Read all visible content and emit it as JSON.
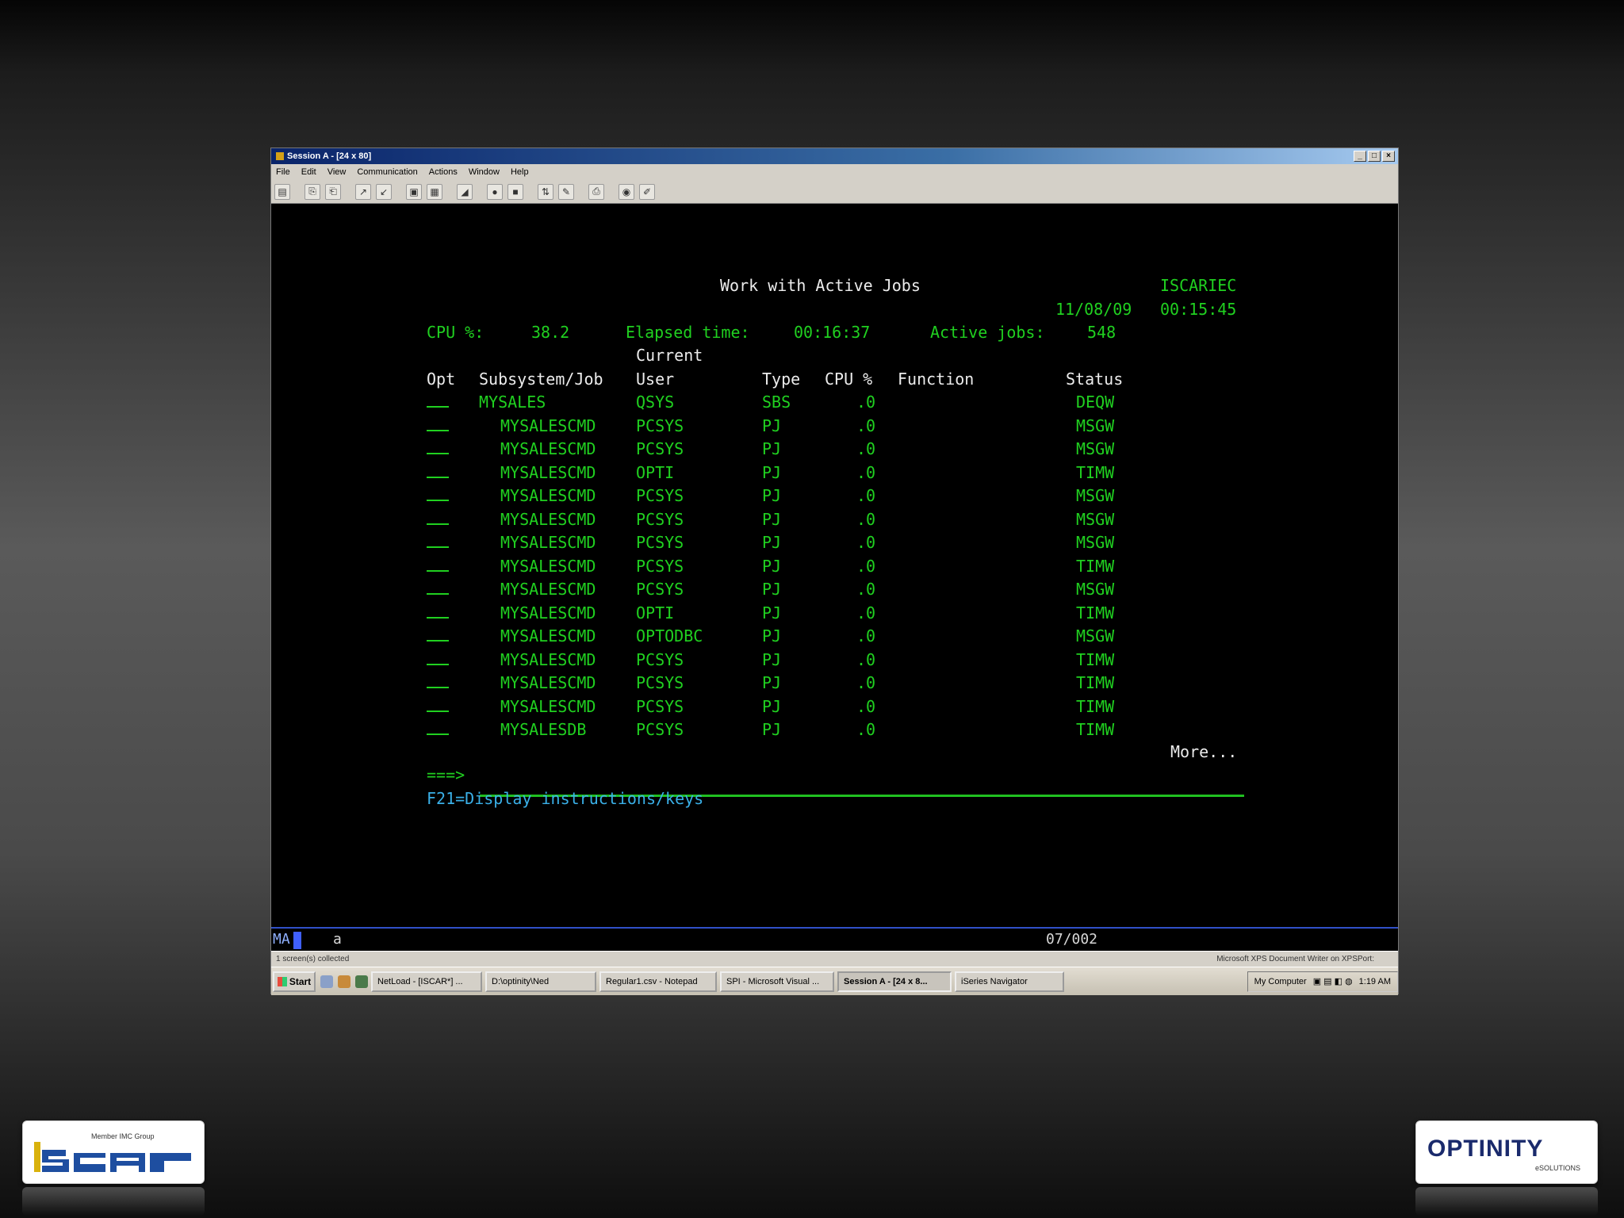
{
  "window": {
    "title": "Session A - [24 x 80]",
    "menu": [
      "File",
      "Edit",
      "View",
      "Communication",
      "Actions",
      "Window",
      "Help"
    ]
  },
  "terminal": {
    "screen_title": "Work with Active Jobs",
    "system_name": "ISCARIEC",
    "date": "11/08/09",
    "time": "00:15:45",
    "cpu_label": "CPU %:",
    "cpu_value": "38.2",
    "elapsed_label": "Elapsed time:",
    "elapsed_value": "00:16:37",
    "active_jobs_label": "Active jobs:",
    "active_jobs_value": "548",
    "headers": {
      "current": "Current",
      "opt": "Opt",
      "subsystem_job": "Subsystem/Job",
      "user": "User",
      "type": "Type",
      "cpu": "CPU %",
      "function": "Function",
      "status": "Status"
    },
    "rows": [
      {
        "job": "MYSALES",
        "user": "QSYS",
        "type": "SBS",
        "cpu": ".0",
        "status": "DEQW"
      },
      {
        "job": "MYSALESCMD",
        "user": "PCSYS",
        "type": "PJ",
        "cpu": ".0",
        "status": "MSGW"
      },
      {
        "job": "MYSALESCMD",
        "user": "PCSYS",
        "type": "PJ",
        "cpu": ".0",
        "status": "MSGW"
      },
      {
        "job": "MYSALESCMD",
        "user": "OPTI",
        "type": "PJ",
        "cpu": ".0",
        "status": "TIMW"
      },
      {
        "job": "MYSALESCMD",
        "user": "PCSYS",
        "type": "PJ",
        "cpu": ".0",
        "status": "MSGW"
      },
      {
        "job": "MYSALESCMD",
        "user": "PCSYS",
        "type": "PJ",
        "cpu": ".0",
        "status": "MSGW"
      },
      {
        "job": "MYSALESCMD",
        "user": "PCSYS",
        "type": "PJ",
        "cpu": ".0",
        "status": "MSGW"
      },
      {
        "job": "MYSALESCMD",
        "user": "PCSYS",
        "type": "PJ",
        "cpu": ".0",
        "status": "TIMW"
      },
      {
        "job": "MYSALESCMD",
        "user": "PCSYS",
        "type": "PJ",
        "cpu": ".0",
        "status": "MSGW"
      },
      {
        "job": "MYSALESCMD",
        "user": "OPTI",
        "type": "PJ",
        "cpu": ".0",
        "status": "TIMW"
      },
      {
        "job": "MYSALESCMD",
        "user": "OPTODBC",
        "type": "PJ",
        "cpu": ".0",
        "status": "MSGW"
      },
      {
        "job": "MYSALESCMD",
        "user": "PCSYS",
        "type": "PJ",
        "cpu": ".0",
        "status": "TIMW"
      },
      {
        "job": "MYSALESCMD",
        "user": "PCSYS",
        "type": "PJ",
        "cpu": ".0",
        "status": "TIMW"
      },
      {
        "job": "MYSALESCMD",
        "user": "PCSYS",
        "type": "PJ",
        "cpu": ".0",
        "status": "TIMW"
      },
      {
        "job": "MYSALESDB",
        "user": "PCSYS",
        "type": "PJ",
        "cpu": ".0",
        "status": "TIMW"
      }
    ],
    "more": "More...",
    "prompt": "===>",
    "fkeys": "F21=Display instructions/keys"
  },
  "oia": {
    "mode": "MA",
    "indicator": "a",
    "cursor_pos": "07/002"
  },
  "status_bar": {
    "left": "1 screen(s) collected",
    "right": "Microsoft XPS Document Writer on XPSPort:"
  },
  "taskbar": {
    "start": "Start",
    "tasks": [
      "NetLoad - [ISCAR*] ...",
      "D:\\optinity\\Ned",
      "Regular1.csv - Notepad",
      "SPI - Microsoft Visual ...",
      "Session A - [24 x 8...",
      "iSeries Navigator"
    ],
    "active_task": 4,
    "tray_label": "My Computer",
    "clock": "1:19 AM"
  },
  "logos": {
    "iscar_tagline": "Member IMC Group",
    "optinity_name": "OPTINITY",
    "optinity_sub": "eSOLUTIONS"
  },
  "colors": {
    "terminal_green": "#20d020",
    "terminal_white": "#ececec",
    "terminal_blue": "#3ab0e8"
  }
}
